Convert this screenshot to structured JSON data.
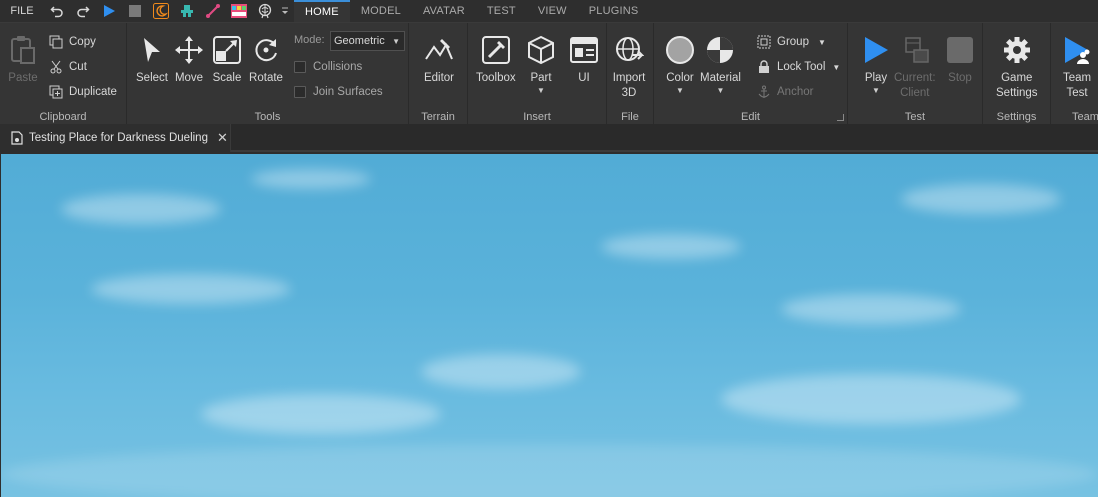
{
  "menu": {
    "file": "FILE",
    "tabs": [
      "HOME",
      "MODEL",
      "AVATAR",
      "TEST",
      "VIEW",
      "PLUGINS"
    ],
    "active_tab": "HOME"
  },
  "quick_access": [
    "undo-icon",
    "redo-icon",
    "play-icon",
    "stop-icon",
    "moon-icon",
    "character-icon",
    "line-tool-icon",
    "palette-icon",
    "brain-icon",
    "more-icon"
  ],
  "ribbon": {
    "clipboard": {
      "label": "Clipboard",
      "paste": "Paste",
      "copy": "Copy",
      "cut": "Cut",
      "duplicate": "Duplicate"
    },
    "tools": {
      "label": "Tools",
      "select": "Select",
      "move": "Move",
      "scale": "Scale",
      "rotate": "Rotate",
      "mode_label": "Mode:",
      "mode_value": "Geometric",
      "collisions": "Collisions",
      "join_surfaces": "Join Surfaces"
    },
    "terrain": {
      "label": "Terrain",
      "editor": "Editor"
    },
    "insert": {
      "label": "Insert",
      "toolbox": "Toolbox",
      "part": "Part",
      "ui": "UI"
    },
    "file": {
      "label": "File",
      "import3d_line1": "Import",
      "import3d_line2": "3D"
    },
    "edit": {
      "label": "Edit",
      "color": "Color",
      "material": "Material",
      "group": "Group",
      "lock_tool": "Lock Tool",
      "anchor": "Anchor"
    },
    "test": {
      "label": "Test",
      "play": "Play",
      "current_line1": "Current:",
      "current_line2": "Client",
      "stop": "Stop"
    },
    "settings": {
      "label": "Settings",
      "game_line1": "Game",
      "game_line2": "Settings"
    },
    "team": {
      "label": "Team",
      "line1": "Team",
      "line2": "Test"
    }
  },
  "document": {
    "tab_title": "Testing Place for Darkness Dueling",
    "close": "✕"
  },
  "colors": {
    "accent": "#3b8fd9",
    "ribbon_bg": "#353535",
    "menubar_bg": "#2e2e2e",
    "sky": "#5ab2da"
  }
}
